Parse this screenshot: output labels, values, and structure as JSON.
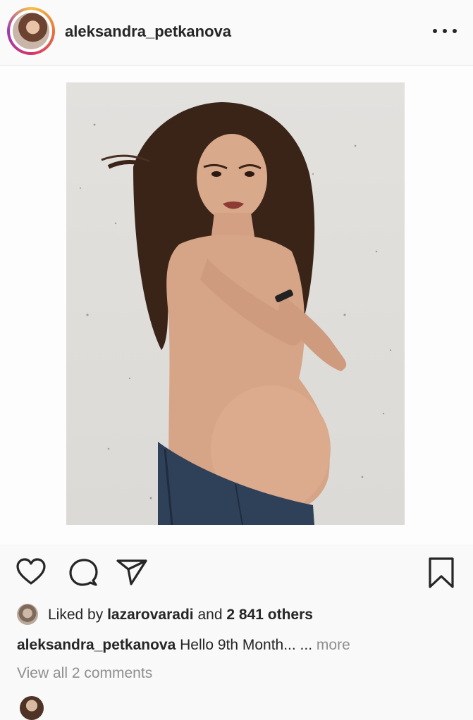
{
  "post": {
    "username": "aleksandra_petkanova",
    "more_icon": "ellipsis-icon"
  },
  "actions": {
    "like_icon": "heart-icon",
    "comment_icon": "comment-icon",
    "share_icon": "paper-plane-icon",
    "save_icon": "bookmark-icon"
  },
  "likes": {
    "prefix": "Liked by",
    "liker": "lazarovaradi",
    "connector": "and",
    "others": "2 841 others"
  },
  "caption": {
    "username": "aleksandra_petkanova",
    "text": "Hello 9th Month... ...",
    "more_label": "more"
  },
  "comments": {
    "view_label": "View all 2 comments"
  },
  "colors": {
    "text": "#262626",
    "muted": "#8e8e8e",
    "background": "#fafafa"
  }
}
